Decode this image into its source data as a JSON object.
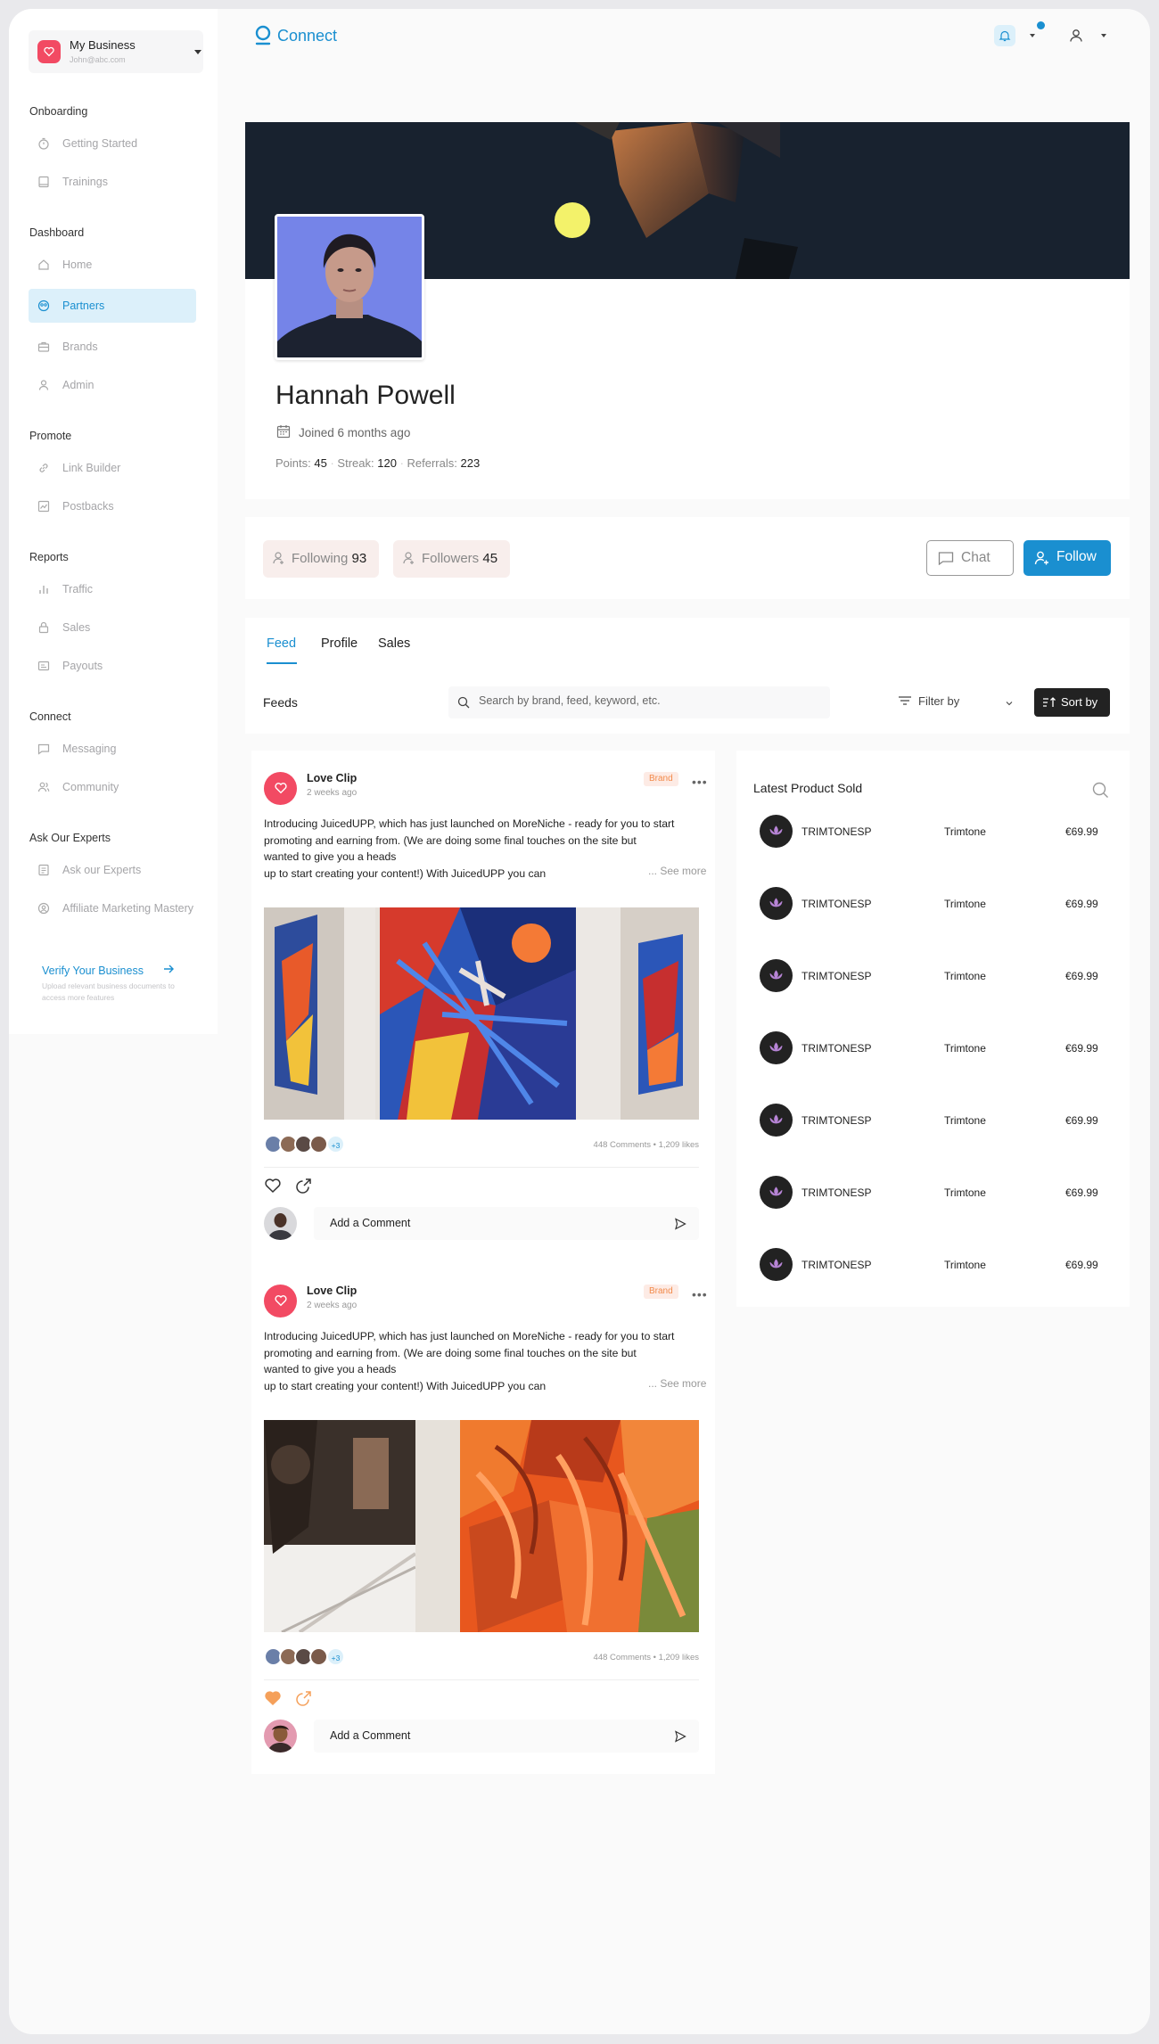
{
  "sidebar": {
    "business": {
      "name": "My Business",
      "email": "John@abc.com"
    },
    "sections": {
      "onboarding": "Onboarding",
      "dashboard": "Dashboard",
      "promote": "Promote",
      "reports": "Reports",
      "connect": "Connect",
      "experts": "Ask Our Experts"
    },
    "items": {
      "getting_started": "Getting  Started",
      "trainings": "Trainings",
      "home": "Home",
      "partners": "Partners",
      "brands": "Brands",
      "admin": "Admin",
      "link_builder": "Link Builder",
      "postbacks": "Postbacks",
      "traffic": "Traffic",
      "sales": "Sales",
      "payouts": "Payouts",
      "messaging": "Messaging",
      "community": "Community",
      "ask_experts": "Ask our Experts",
      "affiliate": "Affiliate Marketing Mastery"
    },
    "verify": {
      "title": "Verify Your Business",
      "subtitle": "Upload relevant business documents to access more features"
    }
  },
  "topbar": {
    "brand": "Connect"
  },
  "colors": {
    "accent": "#1a8fd0",
    "brand_red": "#f24a63",
    "badge": "#f28a4a"
  },
  "profile": {
    "name": "Hannah Powell",
    "joined": "Joined 6 months ago",
    "points_label": "Points:",
    "points": "45",
    "streak_label": "Streak:",
    "streak": "120",
    "referrals_label": "Referrals:",
    "referrals": "223"
  },
  "social": {
    "following_label": "Following",
    "following": "93",
    "followers_label": "Followers",
    "followers": "45",
    "chat": "Chat",
    "follow": "Follow"
  },
  "tabs": [
    "Feed",
    "Profile",
    "Sales"
  ],
  "feeds": {
    "label": "Feeds",
    "search_placeholder": "Search by brand, feed, keyword, etc.",
    "filter": "Filter by",
    "sort": "Sort by"
  },
  "posts": [
    {
      "author": "Love Clip",
      "time": "2 weeks ago",
      "badge": "Brand",
      "text_lines": [
        "Introducing JuicedUPP, which has just launched on MoreNiche - ready for you to start",
        "promoting and earning from. (We are doing some final touches on the site but",
        "wanted to give you a heads",
        "up to start creating your content!) With JuicedUPP you can"
      ],
      "see_more": "... See more",
      "extra_count": "+3",
      "stats": "448 Comments • 1,209 likes",
      "comment_placeholder": "Add a Comment"
    },
    {
      "author": "Love Clip",
      "time": "2 weeks ago",
      "badge": "Brand",
      "text_lines": [
        "Introducing JuicedUPP, which has just launched on MoreNiche - ready for you to start",
        "promoting and earning from. (We are doing some final touches on the site but",
        "wanted to give you a heads",
        "up to start creating your content!) With JuicedUPP you can"
      ],
      "see_more": "... See more",
      "extra_count": "+3",
      "stats": "448 Comments • 1,209 likes",
      "comment_placeholder": "Add a Comment"
    }
  ],
  "latest_sold": {
    "title": "Latest Product Sold",
    "rows": [
      {
        "name": "TRIMTONESP",
        "brand": "Trimtone",
        "price": "€69.99"
      },
      {
        "name": "TRIMTONESP",
        "brand": "Trimtone",
        "price": "€69.99"
      },
      {
        "name": "TRIMTONESP",
        "brand": "Trimtone",
        "price": "€69.99"
      },
      {
        "name": "TRIMTONESP",
        "brand": "Trimtone",
        "price": "€69.99"
      },
      {
        "name": "TRIMTONESP",
        "brand": "Trimtone",
        "price": "€69.99"
      },
      {
        "name": "TRIMTONESP",
        "brand": "Trimtone",
        "price": "€69.99"
      },
      {
        "name": "TRIMTONESP",
        "brand": "Trimtone",
        "price": "€69.99"
      }
    ]
  }
}
